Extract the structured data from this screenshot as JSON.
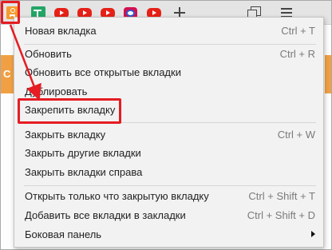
{
  "tabs": [
    {
      "icon": "odnoklassniki-icon",
      "pinned": true,
      "highlighted": true
    },
    {
      "icon": "google-sheets-icon",
      "pinned": true
    },
    {
      "icon": "youtube-icon",
      "pinned": true
    },
    {
      "icon": "youtube-icon",
      "pinned": true
    },
    {
      "icon": "youtube-icon",
      "pinned": true
    },
    {
      "icon": "lightning-app-icon",
      "pinned": true
    },
    {
      "icon": "youtube-icon",
      "pinned": true
    }
  ],
  "page": {
    "strip_letter": "С"
  },
  "menu": {
    "items": [
      {
        "label": "Новая вкладка",
        "shortcut": "Ctrl + T"
      },
      {
        "label": "Обновить",
        "shortcut": "Ctrl + R"
      },
      {
        "label": "Обновить все открытые вкладки",
        "shortcut": ""
      },
      {
        "label": "Дублировать",
        "shortcut": ""
      },
      {
        "label": "Закрепить вкладку",
        "shortcut": "",
        "highlighted": true
      },
      {
        "label": "Закрыть вкладку",
        "shortcut": "Ctrl + W"
      },
      {
        "label": "Закрыть другие вкладки",
        "shortcut": ""
      },
      {
        "label": "Закрыть вкладки справа",
        "shortcut": ""
      },
      {
        "label": "Открыть только что закрытую вкладку",
        "shortcut": "Ctrl + Shift + T"
      },
      {
        "label": "Добавить все вкладки в закладки",
        "shortcut": "Ctrl + Shift + D"
      },
      {
        "label": "Боковая панель",
        "shortcut": "",
        "submenu": true
      }
    ]
  },
  "colors": {
    "annotation": "#e51c23",
    "tab_bar": "#e4e4e4",
    "menu_background": "#f2f2f2",
    "accent_orange": "#f59b2f"
  }
}
